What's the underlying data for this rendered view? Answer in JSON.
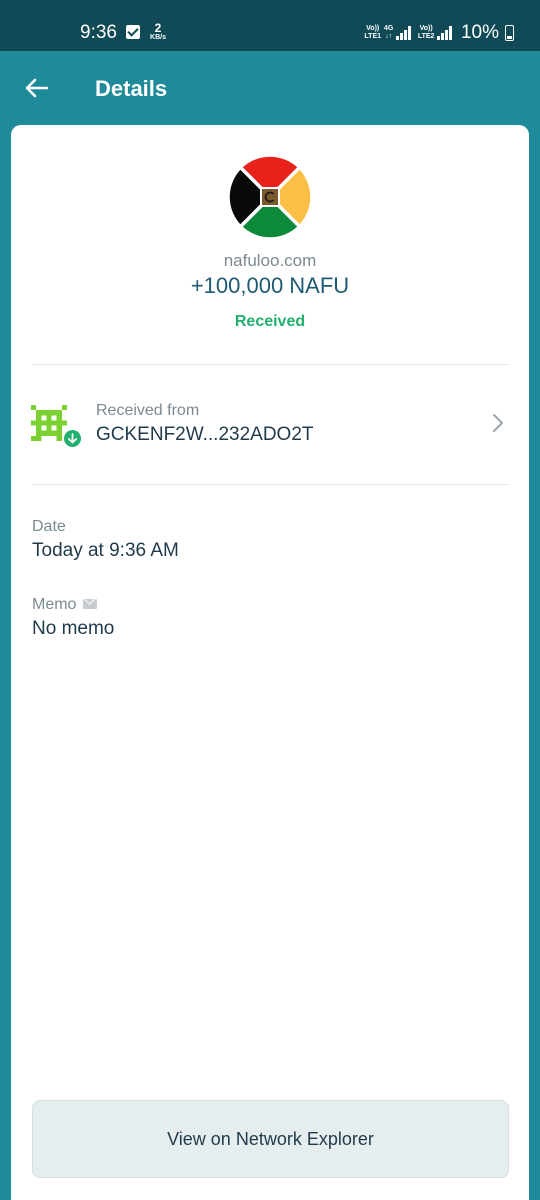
{
  "status_bar": {
    "time": "9:36",
    "net_speed_value": "2",
    "net_speed_unit": "KB/s",
    "sim1_top": "Vo))",
    "sim1_bottom": "LTE1",
    "net_type_top": "4G",
    "net_type_bottom": "↓↑",
    "sim2_top": "Vo))",
    "sim2_bottom": "LTE2",
    "battery": "10%"
  },
  "header": {
    "title": "Details",
    "back_icon": "arrow-left-icon"
  },
  "transaction": {
    "domain": "nafuloo.com",
    "amount": "+100,000 NAFU",
    "status": "Received",
    "logo_icon": "nafu-token-logo",
    "logo_colors": [
      "#e8221b",
      "#fcbf45",
      "#0c8a3a",
      "#0a0a0a"
    ]
  },
  "sender": {
    "label": "Received from",
    "address": "GCKENF2W...232ADO2T",
    "avatar_icon": "identicon-avatar",
    "avatar_color": "#7bd132"
  },
  "details": {
    "date_label": "Date",
    "date_value": "Today at 9:36 AM",
    "memo_label": "Memo",
    "memo_value": "No memo"
  },
  "actions": {
    "explorer_label": "View on Network Explorer"
  },
  "colors": {
    "header_bg": "#1e8a9a",
    "status_bar_bg": "#0f4a56",
    "amount_text": "#1f5a73",
    "status_green": "#21b06f"
  }
}
